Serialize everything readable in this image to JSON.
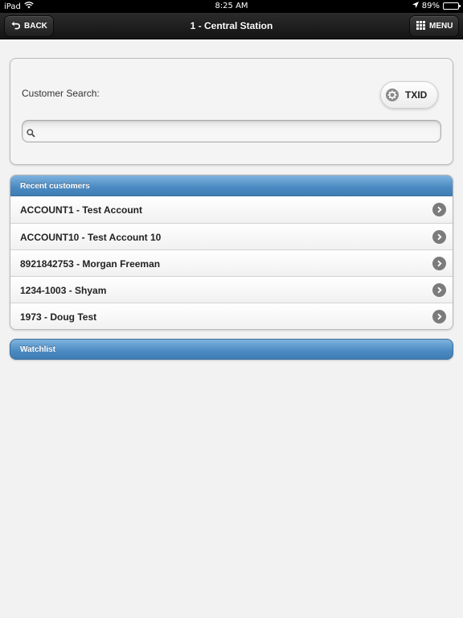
{
  "status_bar": {
    "device": "iPad",
    "time": "8:25 AM",
    "battery": "89%",
    "battery_level": 0.89
  },
  "header": {
    "back_label": "BACK",
    "title": "1 - Central Station",
    "menu_label": "MENU"
  },
  "search": {
    "label": "Customer Search:",
    "txid_label": "TXID",
    "value": "",
    "placeholder": ""
  },
  "recent": {
    "header": "Recent customers",
    "items": [
      {
        "label": "ACCOUNT1 - Test Account"
      },
      {
        "label": "ACCOUNT10 - Test Account 10"
      },
      {
        "label": "8921842753 - Morgan Freeman"
      },
      {
        "label": "1234-1003 - Shyam"
      },
      {
        "label": "1973 - Doug Test"
      }
    ]
  },
  "watchlist": {
    "header": "Watchlist"
  },
  "colors": {
    "accent_blue": "#4a89c1",
    "header_bg": "#1e1e1e",
    "page_bg": "#f2f2f2"
  },
  "icons": {
    "back": "undo-arrow-icon",
    "menu": "grid-icon",
    "txid": "gear-icon",
    "search": "search-icon",
    "row": "chevron-right-icon",
    "wifi": "wifi-icon",
    "location": "location-arrow-icon",
    "battery": "battery-icon"
  }
}
